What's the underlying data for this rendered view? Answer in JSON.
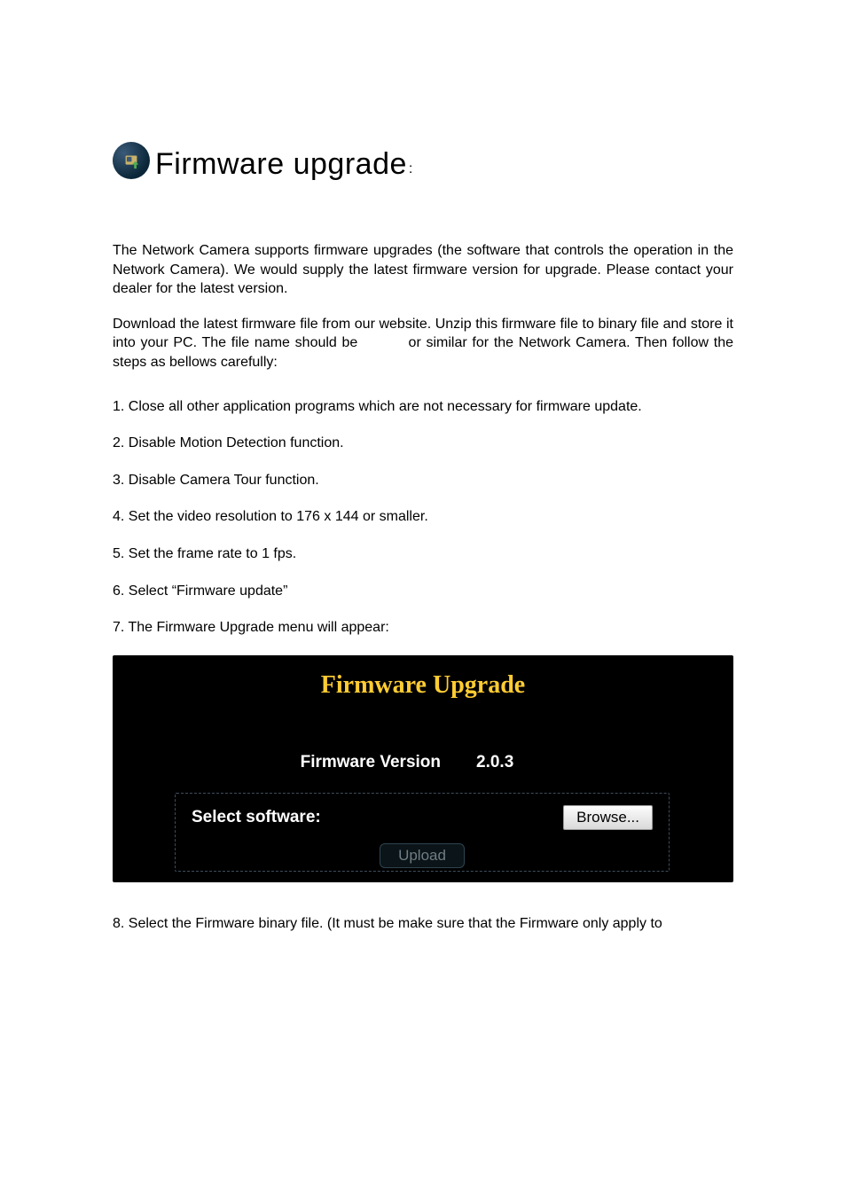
{
  "heading": {
    "title": "Firmware upgrade",
    "colon": ":"
  },
  "paragraphs": {
    "p1": "The Network Camera supports firmware upgrades (the software that controls the operation in the Network Camera). We would supply the latest firmware version for upgrade. Please contact your dealer for the latest version.",
    "p2a": "Download the latest firmware file from our website. Unzip this firmware file to binary file and store it into your PC. The file name should be",
    "p2b": "or similar for the Network Camera. Then follow the steps as bellows carefully:"
  },
  "steps": {
    "s1": "1. Close all other application programs which are not necessary for firmware update.",
    "s2": "2. Disable Motion Detection function.",
    "s3": "3. Disable Camera Tour function.",
    "s4": "4. Set the video resolution to 176 x 144 or smaller.",
    "s5": "5. Set the frame rate to 1 fps.",
    "s6": "6. Select “Firmware update”",
    "s7": "7. The Firmware Upgrade menu will appear:",
    "s8": "8. Select the Firmware binary file. (It must be make sure that the Firmware only apply to"
  },
  "panel": {
    "title": "Firmware Upgrade",
    "version_label": "Firmware Version",
    "version_value": "2.0.3",
    "select_label": "Select software:",
    "browse_label": "Browse...",
    "upload_label": "Upload"
  }
}
